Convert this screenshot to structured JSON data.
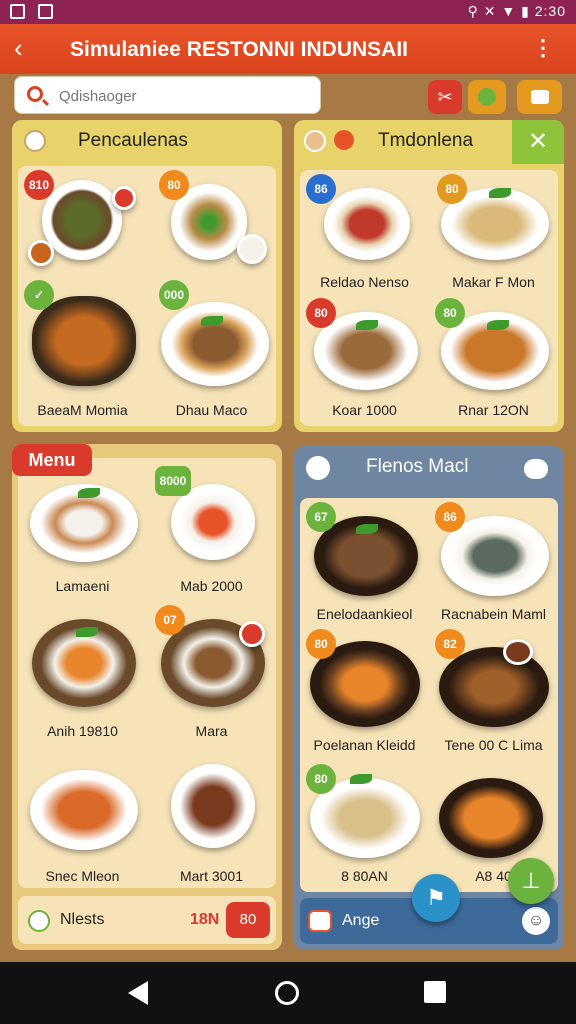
{
  "status": {
    "time": "2:30"
  },
  "appbar": {
    "title": "Simulaniee RESTONNI INDUNSAII"
  },
  "search": {
    "placeholder": "Qdishaoger"
  },
  "panels": {
    "top_left": {
      "title": "Pencaulenas",
      "items": [
        {
          "badge": "810",
          "caption": ""
        },
        {
          "badge": "80",
          "caption": ""
        },
        {
          "badge": "",
          "caption": "BaeaM Momia"
        },
        {
          "badge": "000",
          "caption": "Dhau Maco"
        }
      ]
    },
    "top_right": {
      "title": "Tmdonlena",
      "items": [
        {
          "badge": "86",
          "caption": "Reldao Nenso"
        },
        {
          "badge": "80",
          "caption": "Makar F Mon"
        },
        {
          "badge": "80",
          "caption": "Koar 1000"
        },
        {
          "badge": "80",
          "caption": "Rnar 12ON"
        }
      ]
    },
    "menu": {
      "title": "Menu",
      "items": [
        {
          "badge": "",
          "caption": "Lamaeni"
        },
        {
          "badge": "8000",
          "caption": "Mab 2000"
        },
        {
          "badge": "",
          "caption": "Anih 19810"
        },
        {
          "badge": "07",
          "caption": "Mara"
        },
        {
          "badge": "",
          "caption": "Snec Mleon"
        },
        {
          "badge": "",
          "caption": "Mart 3001"
        }
      ],
      "footer": {
        "label": "Nlests",
        "price": "18N",
        "button": "80"
      }
    },
    "right_bottom": {
      "title": "Flenos Macl",
      "items": [
        {
          "badge": "67",
          "caption": "Enelodaankieol"
        },
        {
          "badge": "86",
          "caption": "Racnabein Maml"
        },
        {
          "badge": "80",
          "caption": "Poelanan Kleidd"
        },
        {
          "badge": "82",
          "caption": "Tene 00 C Lima"
        },
        {
          "badge": "80",
          "caption": "8 80AN"
        },
        {
          "badge": "",
          "caption": "A8 40"
        }
      ],
      "footer": {
        "label": "Ange"
      }
    }
  },
  "colors": {
    "orange": "#e8542a",
    "green": "#6cb33e",
    "red": "#d93a2b",
    "cream": "#f6e3b8"
  }
}
